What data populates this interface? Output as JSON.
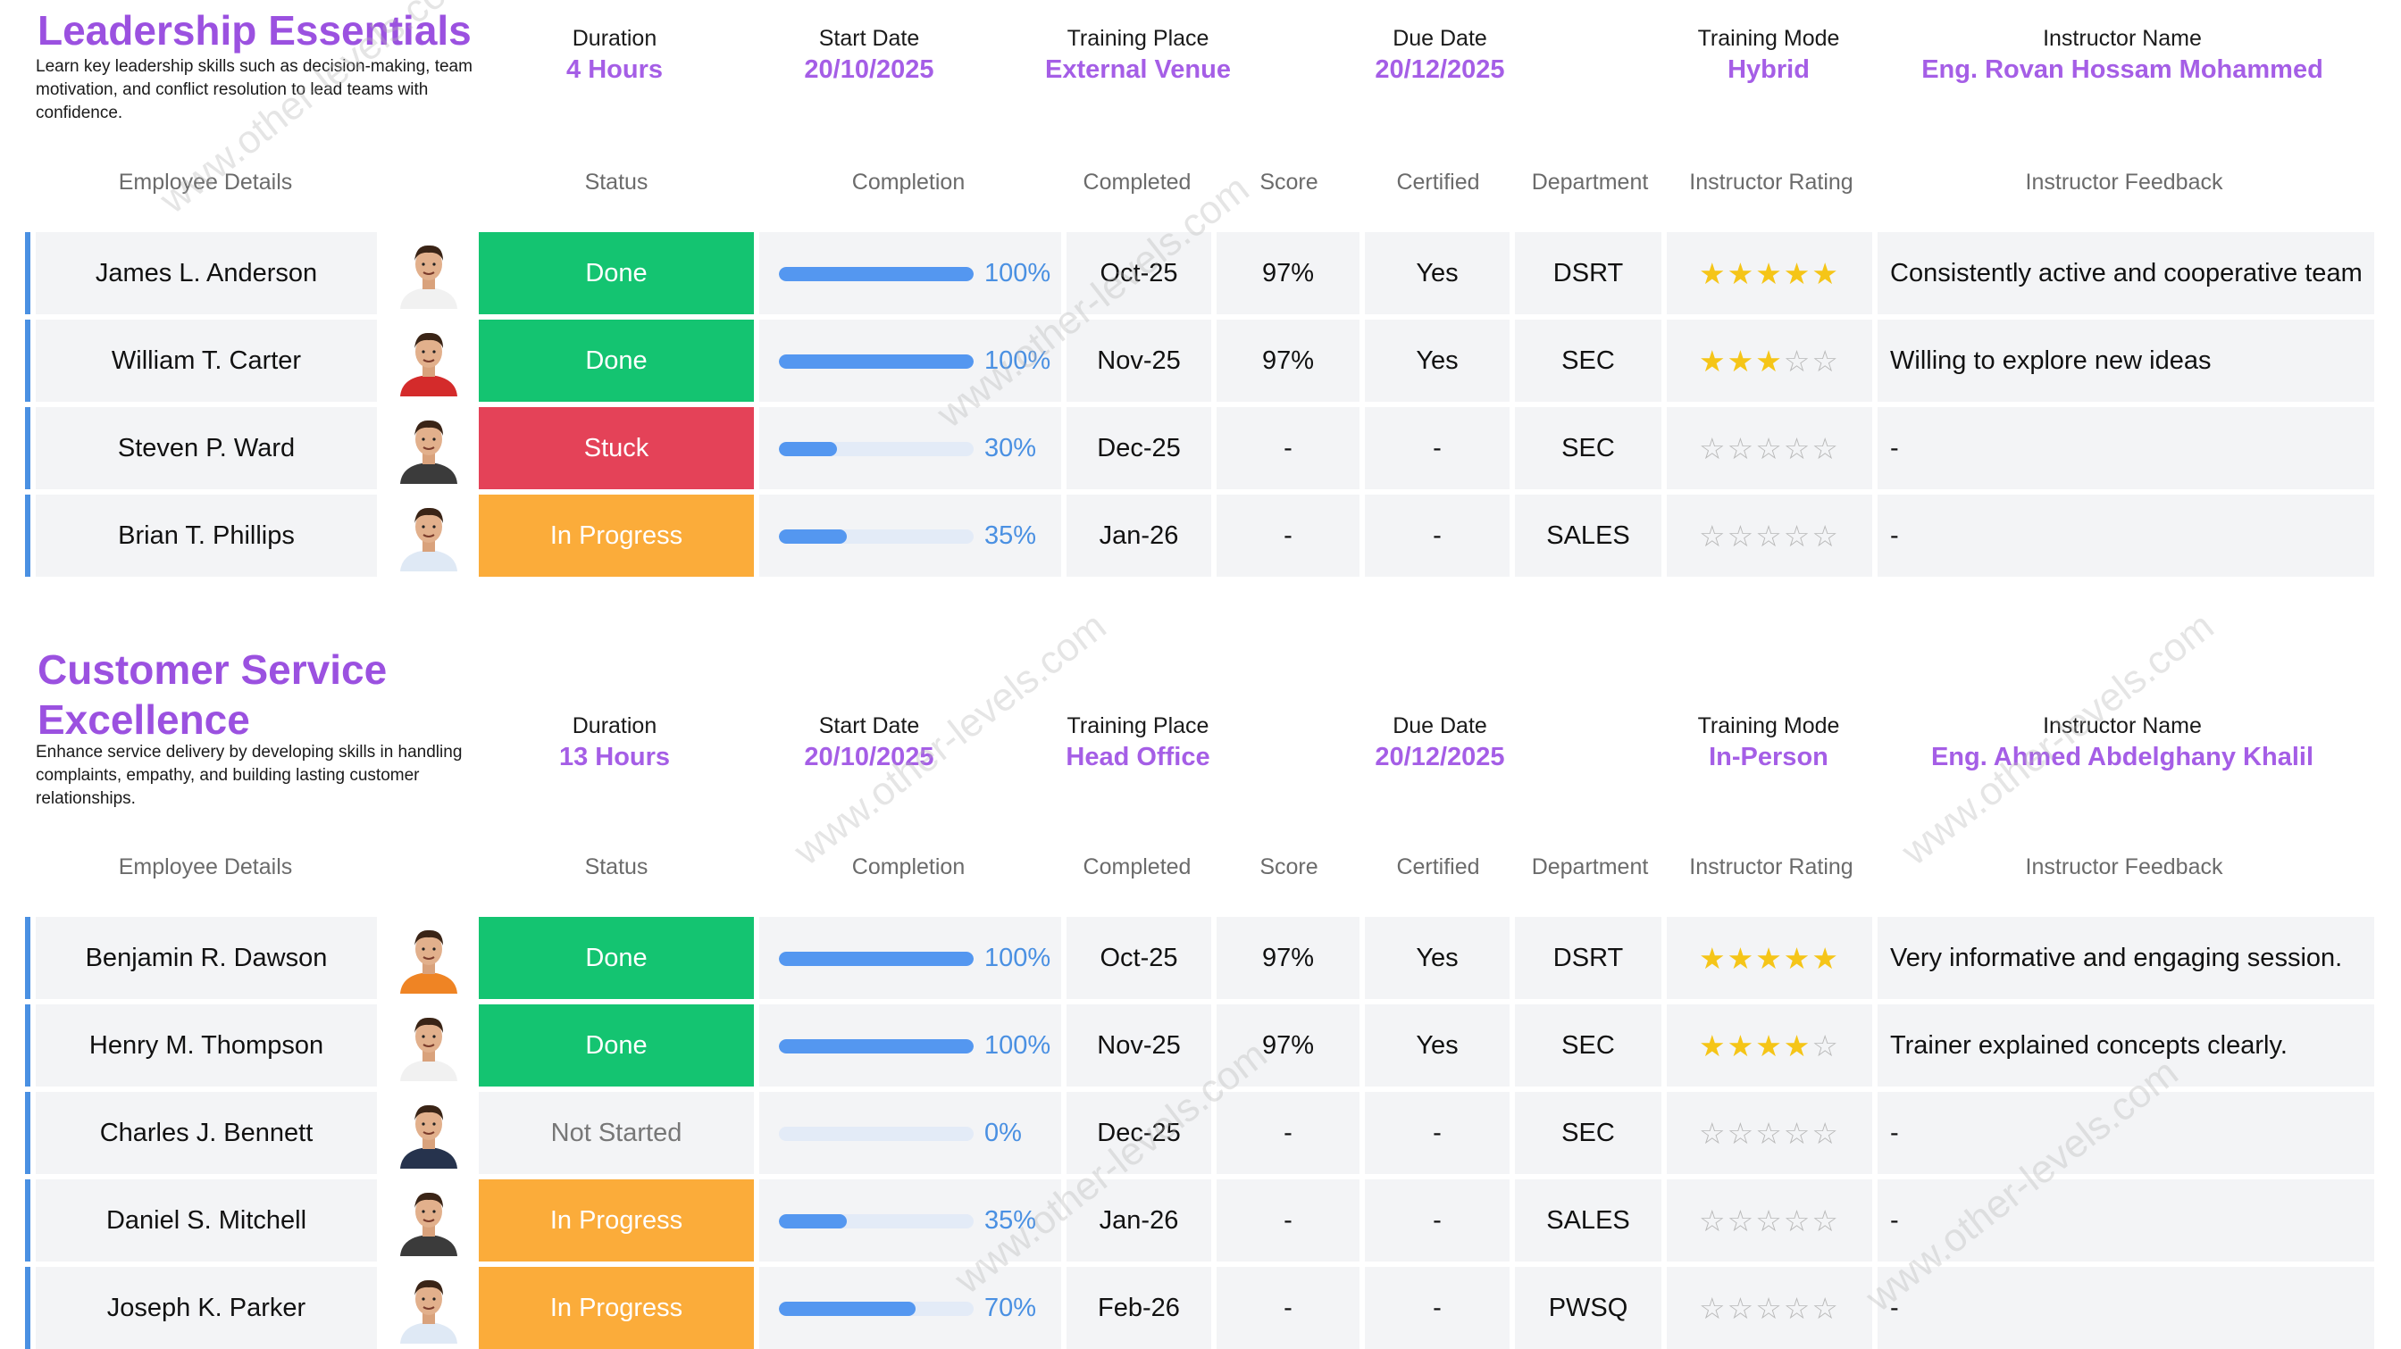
{
  "courses": [
    {
      "title": "Leadership Essentials",
      "description": "Learn key leadership skills such as decision-making, team motivation, and conflict resolution to lead teams with confidence.",
      "info": [
        {
          "label": "Duration",
          "value": "4 Hours"
        },
        {
          "label": "Start Date",
          "value": "20/10/2025"
        },
        {
          "label": "Training Place",
          "value": "External Venue"
        },
        {
          "label": "Due Date",
          "value": "20/12/2025"
        },
        {
          "label": "Training Mode",
          "value": "Hybrid"
        },
        {
          "label": "Instructor Name",
          "value": "Eng. Rovan Hossam Mohammed"
        }
      ],
      "employees": [
        {
          "name": "James L. Anderson",
          "avatar_icon": "man-white-shirt-avatar",
          "status": "Done",
          "status_type": "done",
          "completion": 100,
          "completion_label": "100%",
          "completed": "Oct-25",
          "score": "97%",
          "certified": "Yes",
          "department": "DSRT",
          "rating": 5,
          "feedback": "Consistently active and cooperative team"
        },
        {
          "name": "William T. Carter",
          "avatar_icon": "man-red-shirt-avatar",
          "status": "Done",
          "status_type": "done",
          "completion": 100,
          "completion_label": "100%",
          "completed": "Nov-25",
          "score": "97%",
          "certified": "Yes",
          "department": "SEC",
          "rating": 3,
          "feedback": "Willing to explore new ideas"
        },
        {
          "name": "Steven P. Ward",
          "avatar_icon": "man-dark-shirt-avatar",
          "status": "Stuck",
          "status_type": "stuck",
          "completion": 30,
          "completion_label": "30%",
          "completed": "Dec-25",
          "score": "-",
          "certified": "-",
          "department": "SEC",
          "rating": 0,
          "feedback": "-"
        },
        {
          "name": "Brian T. Phillips",
          "avatar_icon": "man-light-shirt-avatar",
          "status": "In Progress",
          "status_type": "progress",
          "completion": 35,
          "completion_label": "35%",
          "completed": "Jan-26",
          "score": "-",
          "certified": "-",
          "department": "SALES",
          "rating": 0,
          "feedback": "-"
        }
      ]
    },
    {
      "title": "Customer Service Excellence",
      "description": "Enhance service delivery by developing skills in handling complaints, empathy, and building lasting customer relationships.",
      "info": [
        {
          "label": "Duration",
          "value": "13 Hours"
        },
        {
          "label": "Start Date",
          "value": "20/10/2025"
        },
        {
          "label": "Training Place",
          "value": "Head Office"
        },
        {
          "label": "Due Date",
          "value": "20/12/2025"
        },
        {
          "label": "Training Mode",
          "value": "In-Person"
        },
        {
          "label": "Instructor Name",
          "value": "Eng. Ahmed Abdelghany Khalil"
        }
      ],
      "employees": [
        {
          "name": "Benjamin R. Dawson",
          "avatar_icon": "man-orange-shirt-avatar",
          "status": "Done",
          "status_type": "done",
          "completion": 100,
          "completion_label": "100%",
          "completed": "Oct-25",
          "score": "97%",
          "certified": "Yes",
          "department": "DSRT",
          "rating": 5,
          "feedback": "Very informative and engaging session."
        },
        {
          "name": "Henry M. Thompson",
          "avatar_icon": "man-white-shirt-avatar",
          "status": "Done",
          "status_type": "done",
          "completion": 100,
          "completion_label": "100%",
          "completed": "Nov-25",
          "score": "97%",
          "certified": "Yes",
          "department": "SEC",
          "rating": 4,
          "feedback": "Trainer explained concepts clearly."
        },
        {
          "name": "Charles J. Bennett",
          "avatar_icon": "man-navy-shirt-avatar",
          "status": "Not Started",
          "status_type": "notstarted",
          "completion": 0,
          "completion_label": "0%",
          "completed": "Dec-25",
          "score": "-",
          "certified": "-",
          "department": "SEC",
          "rating": 0,
          "feedback": "-"
        },
        {
          "name": "Daniel S. Mitchell",
          "avatar_icon": "man-dark-shirt-avatar",
          "status": "In Progress",
          "status_type": "progress",
          "completion": 35,
          "completion_label": "35%",
          "completed": "Jan-26",
          "score": "-",
          "certified": "-",
          "department": "SALES",
          "rating": 0,
          "feedback": "-"
        },
        {
          "name": "Joseph K. Parker",
          "avatar_icon": "man-light-shirt-avatar",
          "status": "In Progress",
          "status_type": "progress",
          "completion": 70,
          "completion_label": "70%",
          "completed": "Feb-26",
          "score": "-",
          "certified": "-",
          "department": "PWSQ",
          "rating": 0,
          "feedback": "-"
        }
      ]
    }
  ],
  "column_headers": [
    "Employee Details",
    "Status",
    "Completion",
    "Completed",
    "Score",
    "Certified",
    "Department",
    "Instructor Rating",
    "Instructor Feedback"
  ],
  "watermark": "www.other-levels.com",
  "colors": {
    "accent_purple": "#9b51e0",
    "done_green": "#14c471",
    "stuck_red": "#e44258",
    "progress_orange": "#fbac3a",
    "progress_blue": "#5497f0",
    "star_gold": "#f5c518",
    "row_bar_blue": "#4a90e2"
  }
}
